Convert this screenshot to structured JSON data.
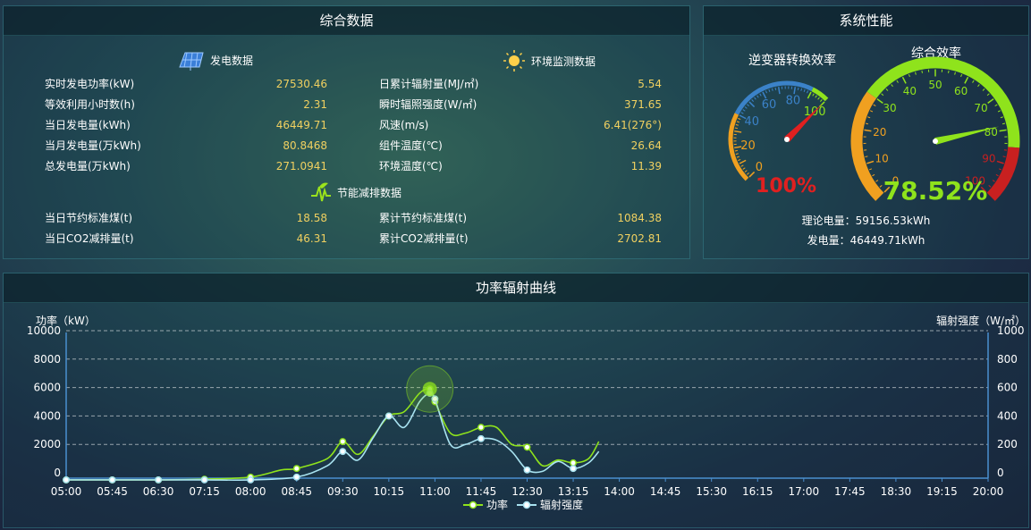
{
  "summary": {
    "title": "综合数据",
    "power": {
      "heading": "发电数据",
      "rows": [
        {
          "label": "实时发电功率(kW)",
          "value": "27530.46"
        },
        {
          "label": "等效利用小时数(h)",
          "value": "2.31"
        },
        {
          "label": "当日发电量(kWh)",
          "value": "46449.71"
        },
        {
          "label": "当月发电量(万kWh)",
          "value": "80.8468"
        },
        {
          "label": "总发电量(万kWh)",
          "value": "271.0941"
        }
      ]
    },
    "env": {
      "heading": "环境监测数据",
      "rows": [
        {
          "label": "日累计辐射量(MJ/㎡)",
          "value": "5.54"
        },
        {
          "label": "瞬时辐照强度(W/㎡)",
          "value": "371.65"
        },
        {
          "label": "风速(m/s)",
          "value": "6.41(276°)"
        },
        {
          "label": "组件温度(℃)",
          "value": "26.64"
        },
        {
          "label": "环境温度(℃)",
          "value": "11.39"
        }
      ]
    },
    "saving": {
      "heading": "节能减排数据",
      "rows_left": [
        {
          "label": "当日节约标准煤(t)",
          "value": "18.58"
        },
        {
          "label": "当日CO2减排量(t)",
          "value": "46.31"
        }
      ],
      "rows_right": [
        {
          "label": "累计节约标准煤(t)",
          "value": "1084.38"
        },
        {
          "label": "累计CO2减排量(t)",
          "value": "2702.81"
        }
      ]
    }
  },
  "performance": {
    "title": "系统性能",
    "inverter": {
      "title": "逆变器转换效率",
      "value": 100,
      "display": "100%",
      "ticks": [
        "0",
        "20",
        "40",
        "60",
        "80",
        "100"
      ]
    },
    "overall": {
      "title": "综合效率",
      "value": 78.52,
      "display": "78.52%",
      "ticks": [
        "0",
        "10",
        "20",
        "30",
        "40",
        "50",
        "60",
        "70",
        "80",
        "90",
        "100"
      ]
    },
    "theory": "理论电量：59156.53kWh",
    "generated": "发电量：46449.71kWh"
  },
  "curve": {
    "title": "功率辐射曲线",
    "colors": {
      "power": "#8fe31c",
      "radiation": "#a8e2f0"
    },
    "chart_data": {
      "type": "line",
      "ylabel_left": "功率（kW）",
      "ylabel_right": "辐射强度（W/㎡）",
      "ylim_left": [
        0,
        10000
      ],
      "ylim_right": [
        0,
        1000
      ],
      "left_ticks": [
        "0",
        "2000",
        "4000",
        "6000",
        "8000",
        "10000"
      ],
      "right_ticks": [
        "0",
        "200",
        "400",
        "600",
        "800",
        "1000"
      ],
      "x_ticks": [
        "05:00",
        "05:45",
        "06:30",
        "07:15",
        "08:00",
        "08:45",
        "09:30",
        "10:15",
        "11:00",
        "11:45",
        "12:30",
        "13:15",
        "14:00",
        "14:45",
        "15:30",
        "16:15",
        "17:00",
        "17:45",
        "18:30",
        "19:15",
        "20:00"
      ],
      "series": [
        {
          "name": "功率",
          "axis": "left",
          "points": [
            [
              "05:00",
              -500
            ],
            [
              "05:45",
              -500
            ],
            [
              "06:30",
              -500
            ],
            [
              "07:15",
              -450
            ],
            [
              "08:00",
              -300
            ],
            [
              "08:30",
              200
            ],
            [
              "08:45",
              300
            ],
            [
              "09:15",
              1000
            ],
            [
              "09:30",
              2200
            ],
            [
              "09:45",
              1300
            ],
            [
              "10:00",
              2600
            ],
            [
              "10:15",
              4000
            ],
            [
              "10:30",
              4300
            ],
            [
              "10:45",
              5600
            ],
            [
              "10:55",
              5900
            ],
            [
              "11:00",
              5000
            ],
            [
              "11:15",
              2800
            ],
            [
              "11:30",
              2800
            ],
            [
              "11:45",
              3200
            ],
            [
              "12:00",
              3200
            ],
            [
              "12:15",
              2000
            ],
            [
              "12:30",
              1800
            ],
            [
              "12:45",
              500
            ],
            [
              "13:00",
              900
            ],
            [
              "13:15",
              700
            ],
            [
              "13:30",
              1000
            ],
            [
              "13:40",
              2200
            ]
          ]
        },
        {
          "name": "辐射强度",
          "axis": "right",
          "points": [
            [
              "05:00",
              -50
            ],
            [
              "05:45",
              -50
            ],
            [
              "06:30",
              -50
            ],
            [
              "07:15",
              -50
            ],
            [
              "08:00",
              -50
            ],
            [
              "08:45",
              -30
            ],
            [
              "09:15",
              50
            ],
            [
              "09:30",
              150
            ],
            [
              "09:45",
              90
            ],
            [
              "10:00",
              250
            ],
            [
              "10:15",
              400
            ],
            [
              "10:30",
              320
            ],
            [
              "10:45",
              500
            ],
            [
              "10:55",
              560
            ],
            [
              "11:00",
              520
            ],
            [
              "11:15",
              200
            ],
            [
              "11:30",
              200
            ],
            [
              "11:45",
              240
            ],
            [
              "12:00",
              230
            ],
            [
              "12:15",
              150
            ],
            [
              "12:30",
              20
            ],
            [
              "12:45",
              10
            ],
            [
              "13:00",
              80
            ],
            [
              "13:15",
              30
            ],
            [
              "13:30",
              70
            ],
            [
              "13:40",
              150
            ]
          ]
        }
      ],
      "legend": [
        "功率",
        "辐射强度"
      ]
    }
  }
}
